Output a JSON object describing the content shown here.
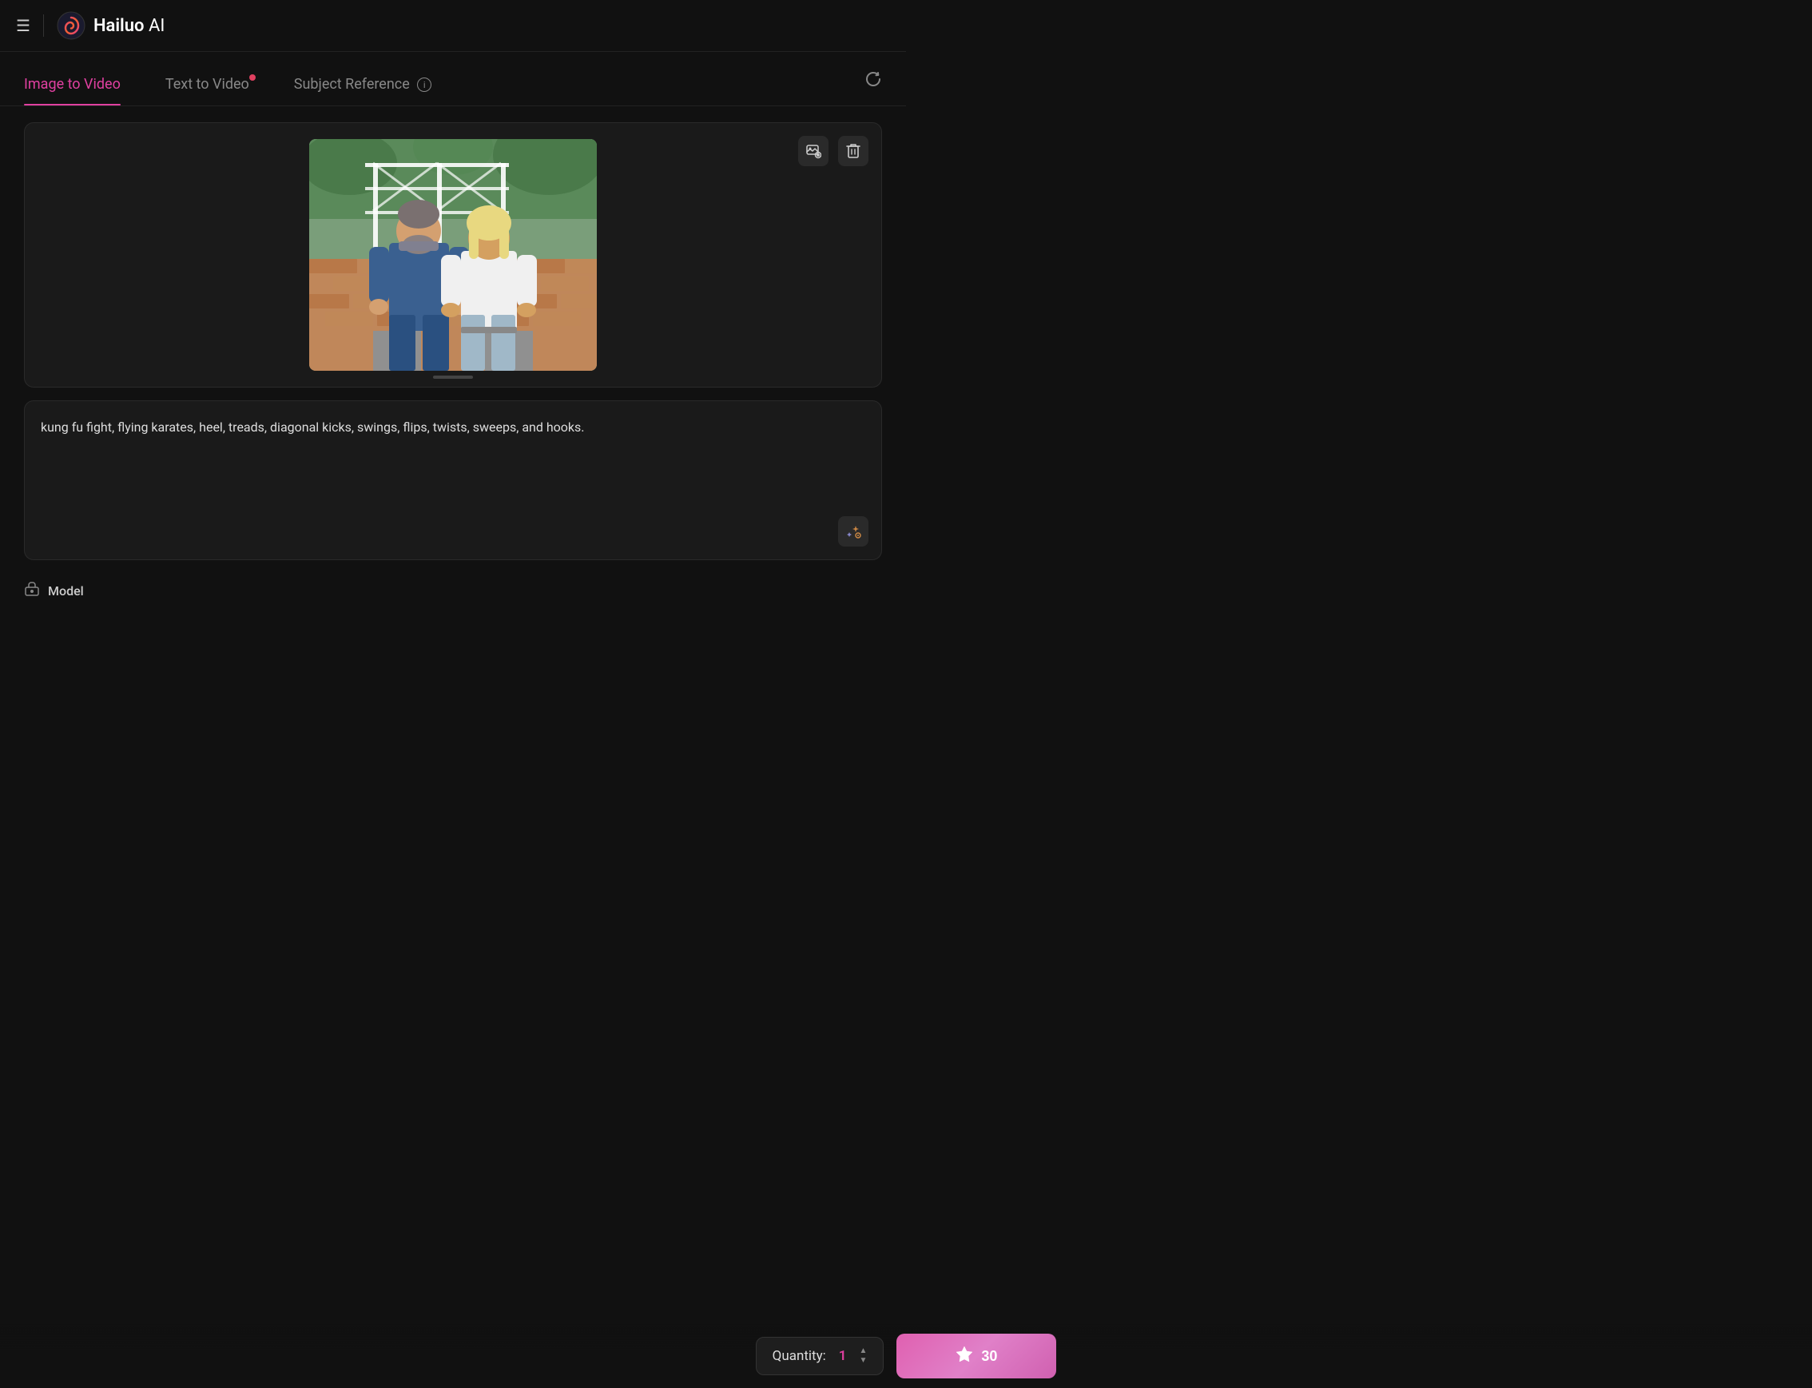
{
  "header": {
    "brand": "Hailuo",
    "brand_suffix": "AI"
  },
  "nav": {
    "tabs": [
      {
        "id": "image-to-video",
        "label": "Image to Video",
        "active": true,
        "badge": false
      },
      {
        "id": "text-to-video",
        "label": "Text to Video",
        "active": false,
        "badge": true
      },
      {
        "id": "subject-reference",
        "label": "Subject Reference",
        "active": false,
        "badge": false,
        "info": true
      }
    ],
    "refresh_label": "↺"
  },
  "image_area": {
    "alt": "Uploaded image of couple",
    "replace_icon": "🖼",
    "delete_icon": "🗑"
  },
  "prompt": {
    "text": "kung fu fight, flying karates, heel, treads, diagonal kicks, swings, flips, twists, sweeps, and hooks.",
    "enhance_icon": "✨"
  },
  "model": {
    "label": "Model",
    "icon": "◇"
  },
  "bottom_bar": {
    "quantity_label": "Quantity:",
    "quantity_value": "1",
    "generate_label": "30",
    "credit_icon": "💎"
  }
}
